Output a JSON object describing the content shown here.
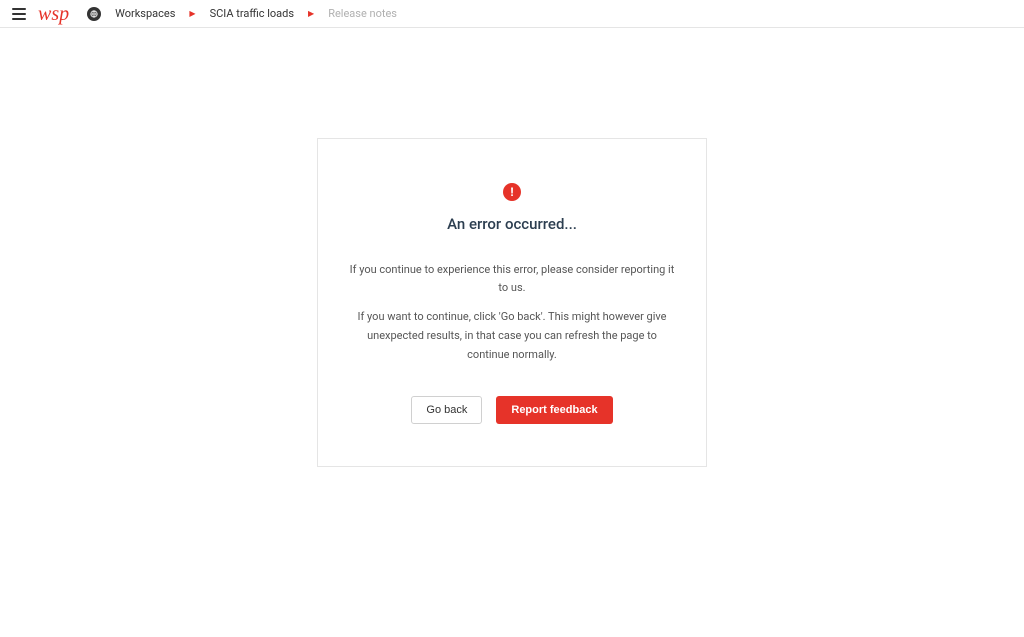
{
  "header": {
    "logo_text": "wsp",
    "breadcrumb": {
      "root": "Workspaces",
      "mid": "SCIA traffic loads",
      "current": "Release notes"
    }
  },
  "error": {
    "badge_glyph": "!",
    "title": "An error occurred...",
    "line1": "If you continue to experience this error, please consider reporting it to us.",
    "line2": "If you want to continue, click 'Go back'. This might however give unexpected results, in that case you can refresh the page to continue normally.",
    "actions": {
      "go_back": "Go back",
      "report": "Report feedback"
    }
  }
}
